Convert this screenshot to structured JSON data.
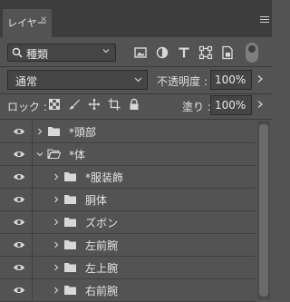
{
  "panel": {
    "tab_label": "レイヤー",
    "tab_close": "×"
  },
  "filter": {
    "label": "種類",
    "icons": [
      "image-filter-icon",
      "adjustment-filter-icon",
      "type-filter-icon",
      "shape-filter-icon",
      "smart-object-filter-icon"
    ]
  },
  "blend": {
    "mode": "通常",
    "opacity_label": "不透明度 :",
    "opacity_value": "100%"
  },
  "lock": {
    "label": "ロック :",
    "fill_label": "塗り :",
    "fill_value": "100%"
  },
  "layers": [
    {
      "name": "*頭部",
      "expanded": false,
      "indent": 0
    },
    {
      "name": "*体",
      "expanded": true,
      "indent": 0
    },
    {
      "name": "*服装飾",
      "expanded": false,
      "indent": 1
    },
    {
      "name": "胴体",
      "expanded": false,
      "indent": 1
    },
    {
      "name": "ズボン",
      "expanded": false,
      "indent": 1
    },
    {
      "name": "左前腕",
      "expanded": false,
      "indent": 1
    },
    {
      "name": "左上腕",
      "expanded": false,
      "indent": 1
    },
    {
      "name": "右前腕",
      "expanded": false,
      "indent": 1
    }
  ]
}
